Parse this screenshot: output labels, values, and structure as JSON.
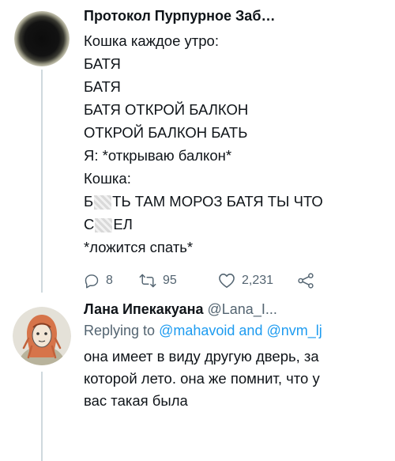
{
  "tweet1": {
    "name": "Протокол Пурпурное Заб…",
    "lines": [
      "Кошка каждое утро:",
      "БАТЯ",
      "БАТЯ",
      "БАТЯ ОТКРОЙ БАЛКОН",
      "ОТКРОЙ БАЛКОН БАТЬ",
      "Я: *открываю балкон*",
      "Кошка:",
      "ТЬ ТАМ МОРОЗ БАТЯ ТЫ ЧТО",
      "ЕЛ",
      "*ложится спать*"
    ],
    "line8_prefix": "Б",
    "line9_prefix": "С",
    "replies": "8",
    "retweets": "95",
    "likes": "2,231"
  },
  "tweet2": {
    "name": "Лана Ипекакуана",
    "handle": "@Lana_I...",
    "replying_prefix": "Replying to",
    "mention1": "@mahavoid",
    "and": "and",
    "mention2": "@nvm_lj",
    "text_lines": [
      "она имеет в виду другую дверь, за",
      "которой лето. она же помнит, что у",
      "вас такая была"
    ]
  },
  "icons": {
    "reply": "reply-icon",
    "retweet": "retweet-icon",
    "like": "heart-icon",
    "share": "share-icon"
  },
  "colors": {
    "text": "#0f1419",
    "secondary": "#536471",
    "link": "#1d9bf0"
  }
}
